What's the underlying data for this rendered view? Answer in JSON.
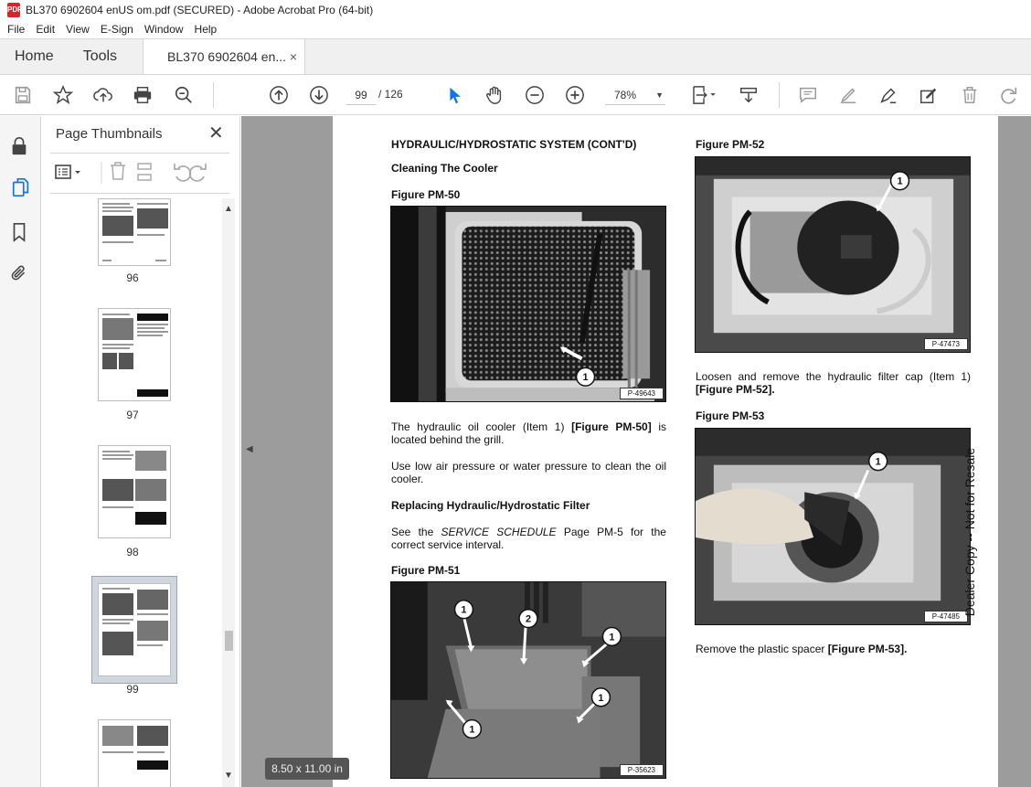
{
  "window": {
    "title": "BL370 6902604 enUS om.pdf (SECURED) - Adobe Acrobat Pro (64-bit)"
  },
  "menu": [
    "File",
    "Edit",
    "View",
    "E-Sign",
    "Window",
    "Help"
  ],
  "tabs": {
    "home": "Home",
    "tools": "Tools",
    "document": "BL370 6902604 en...",
    "close": "×"
  },
  "toolbar": {
    "page_current": "99",
    "page_total": "/  126",
    "zoom": "78%"
  },
  "thumbnails": {
    "title": "Page Thumbnails",
    "close": "✕",
    "pages": [
      "96",
      "97",
      "98",
      "99"
    ],
    "selected": "99"
  },
  "document": {
    "heading": "HYDRAULIC/HYDROSTATIC SYSTEM (CONT'D)",
    "subheading_1": "Cleaning The Cooler",
    "fig50_title": "Figure PM-50",
    "fig50_id": "P-49643",
    "para_1a": "The hydraulic oil cooler (Item 1)",
    "para_1b": "[Figure PM-50]",
    "para_1c": "is located behind the grill.",
    "para_2": "Use low air pressure or water pressure to clean the oil cooler.",
    "subheading_2": "Replacing Hydraulic/Hydrostatic Filter",
    "para_3a": "See the",
    "para_3b": "SERVICE SCHEDULE",
    "para_3c": "Page PM-5 for the correct service interval.",
    "fig51_title": "Figure PM-51",
    "fig51_id": "P-35623",
    "fig52_title": "Figure PM-52",
    "fig52_id": "P-47473",
    "para_4a": "Loosen and remove the hydraulic filter cap (Item 1)",
    "para_4b": "[Figure PM-52].",
    "fig53_title": "Figure PM-53",
    "fig53_id": "P-47485",
    "para_5a": "Remove the plastic spacer",
    "para_5b": "[Figure PM-53].",
    "side_note": "Dealer Copy -- Not for Resale",
    "callout_1": "1",
    "callout_2": "2"
  },
  "status": {
    "page_size": "8.50 x 11.00 in"
  }
}
